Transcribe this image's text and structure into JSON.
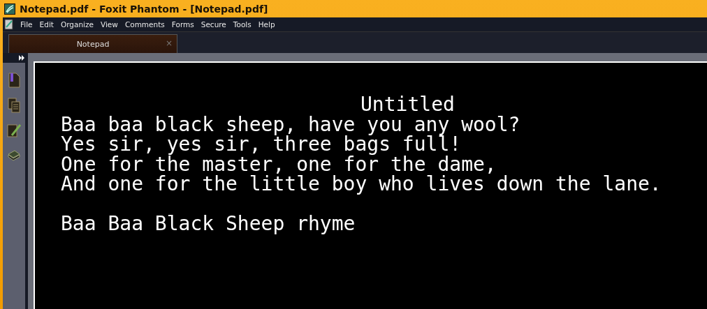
{
  "window": {
    "title": "Notepad.pdf - Foxit Phantom - [Notepad.pdf]"
  },
  "menu": [
    "File",
    "Edit",
    "Organize",
    "View",
    "Comments",
    "Forms",
    "Secure",
    "Tools",
    "Help"
  ],
  "tabs": [
    {
      "label": "Notepad",
      "selected": true
    }
  ],
  "tab_close": "×",
  "document": {
    "title": "Untitled",
    "lines": [
      "Baa baa black sheep, have you any wool?",
      "Yes sir, yes sir, three bags full!",
      "One for the master, one for the dame,",
      "And one for the little boy who lives down the lane."
    ],
    "caption": "Baa Baa Black Sheep rhyme"
  }
}
